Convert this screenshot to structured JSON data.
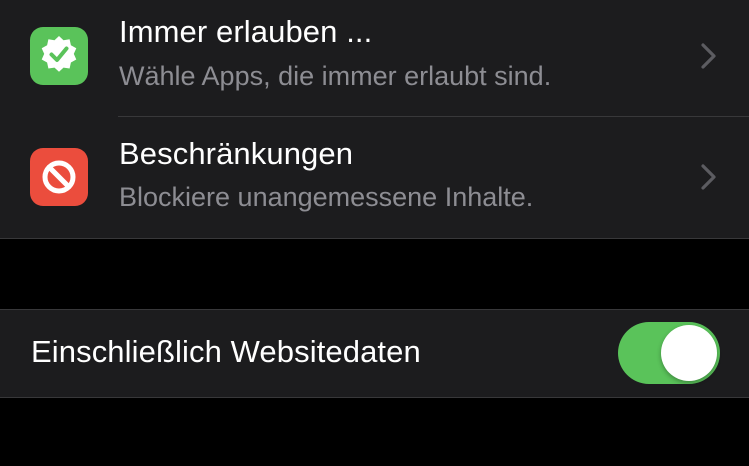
{
  "colors": {
    "group_bg": "#1c1c1e",
    "separator": "#38383a",
    "secondary_text": "#8d8d93",
    "always_allowed_icon": "#5ac35a",
    "content_restrictions_icon": "#eb4d3d",
    "toggle_on": "#5ac35a"
  },
  "settings": {
    "rows": [
      {
        "icon": "checkmark-seal-icon",
        "title": "Immer erlauben ...",
        "subtitle": "Wähle Apps, die immer erlaubt sind."
      },
      {
        "icon": "no-entry-icon",
        "title": "Beschränkungen",
        "subtitle": "Blockiere unangemessene Inhalte."
      }
    ],
    "website_data": {
      "label": "Einschließlich Websitedaten",
      "enabled": true
    }
  }
}
